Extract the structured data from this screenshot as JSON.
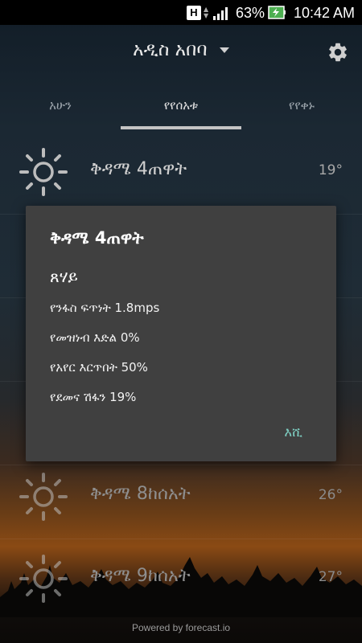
{
  "status_bar": {
    "h_indicator": "H",
    "battery_percent": "63%",
    "time": "10:42 AM",
    "icons": [
      "signal-icon",
      "battery-charging-icon"
    ]
  },
  "app_bar": {
    "city": "አዲስ አበባ",
    "icons": [
      "dropdown-caret-icon",
      "gear-icon"
    ]
  },
  "tabs": [
    {
      "label": "አሁን"
    },
    {
      "label": "የየሰአቱ"
    },
    {
      "label": "የየቀኑ"
    }
  ],
  "active_tab": 1,
  "rows": [
    {
      "label": "ቅዳሜ 4ጠዋት",
      "temp": "19°",
      "icon": "sun-icon"
    },
    {
      "label": "ቅዳሜ 8ከሰአት",
      "temp": "26°",
      "icon": "sun-icon"
    },
    {
      "label": "ቅዳሜ 9ከሰአት",
      "temp": "27°",
      "icon": "sun-icon"
    }
  ],
  "dialog": {
    "title": "ቅዳሜ 4ጠዋት",
    "summary": "ጸሃይ",
    "lines": [
      "የንፋስ ፍጥነት 1.8mps",
      "የመዝነብ እድል 0%",
      "የአየር እርጥበት 50%",
      "የደመና ሽፋን 19%"
    ],
    "ok_label": "እሺ"
  },
  "footer": "Powered by forecast.io",
  "colors": {
    "accent": "#7fd1c4",
    "dialog_bg": "#404040",
    "tab_indicator": "#c4c4c4"
  }
}
